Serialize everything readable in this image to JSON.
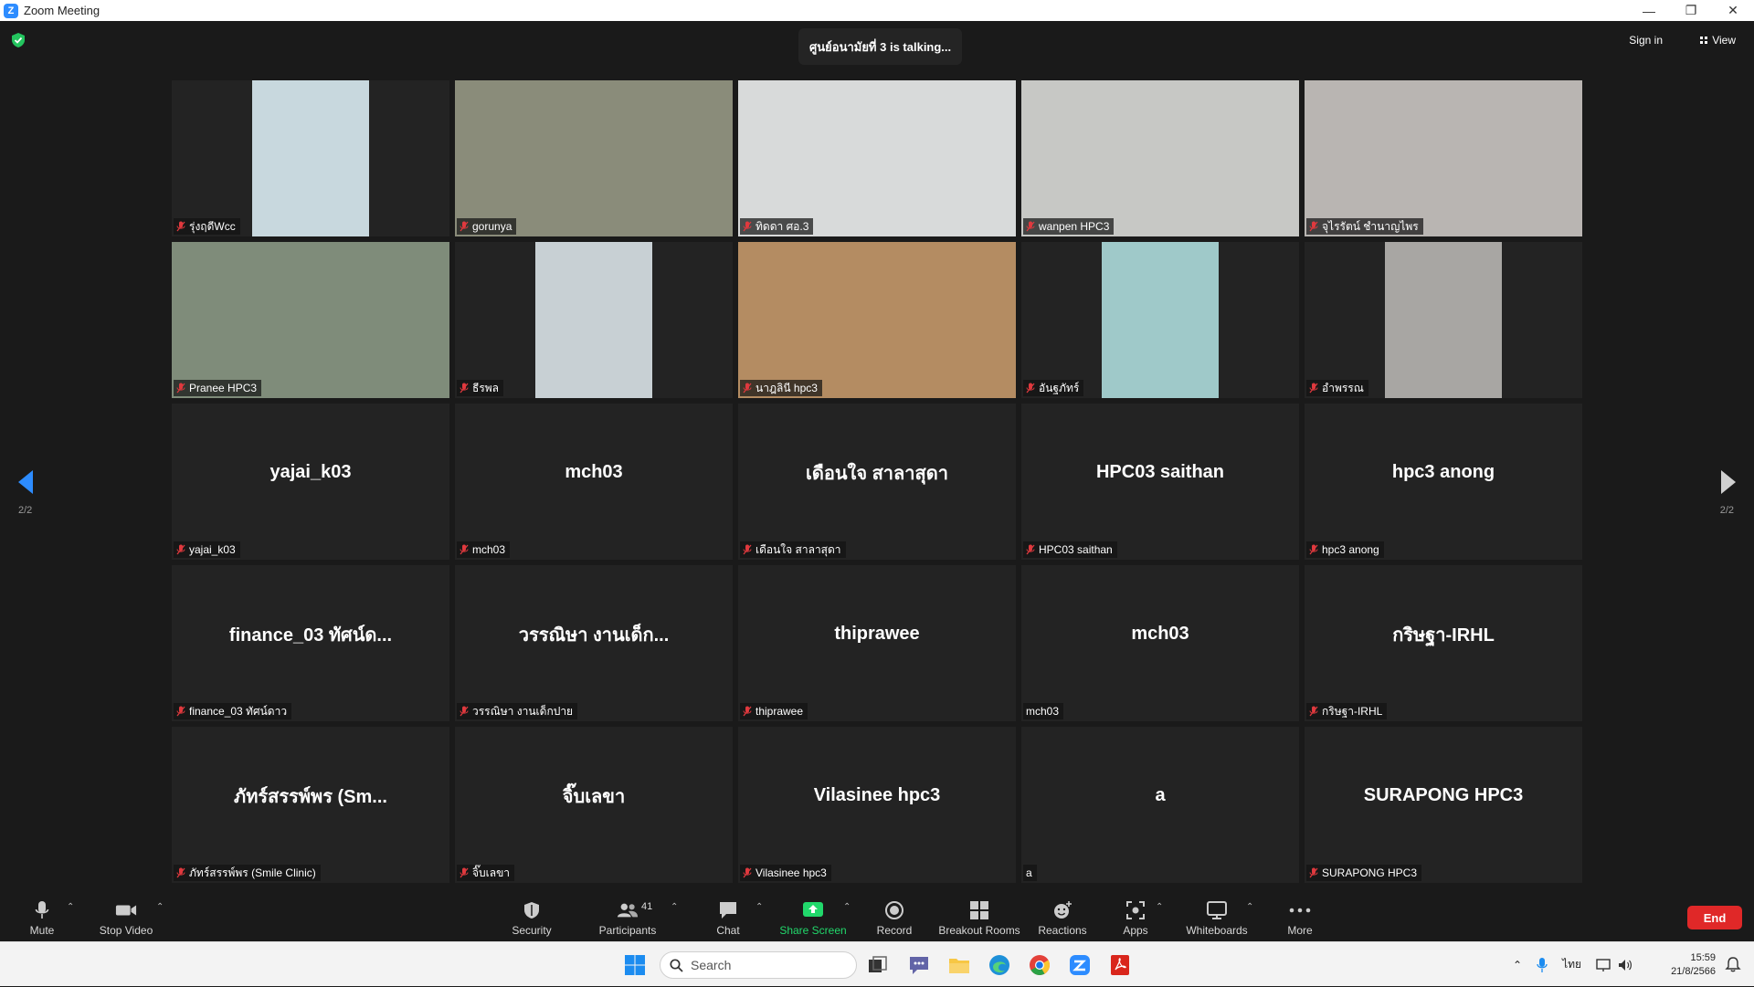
{
  "window": {
    "title": "Zoom Meeting",
    "minimize": "—",
    "restore": "❐",
    "close": "✕"
  },
  "header": {
    "talking": "ศูนย์อนามัยที่ 3 is  talking...",
    "signin": "Sign in",
    "view": "View"
  },
  "pagination": {
    "left": "2/2",
    "right": "2/2"
  },
  "participants": [
    {
      "label": "รุ่งฤดีWcc",
      "video": "narrow",
      "bg": "#c8d8de"
    },
    {
      "label": "gorunya",
      "video": "full",
      "bg": "#8a8c7a"
    },
    {
      "label": "ทิดดา ศอ.3",
      "video": "full",
      "bg": "#d8dada"
    },
    {
      "label": "wanpen HPC3",
      "video": "full",
      "bg": "#c7c8c5"
    },
    {
      "label": "จุไรรัตน์ ชำนาญไพร",
      "video": "full",
      "bg": "#b9b5b2"
    },
    {
      "label": "Pranee HPC3",
      "video": "full",
      "bg": "#7f8c7a"
    },
    {
      "label": "ธีรพล",
      "video": "narrow",
      "bg": "#c8d0d4"
    },
    {
      "label": "นาฎลินี  hpc3",
      "video": "full",
      "bg": "#b48c62"
    },
    {
      "label": "อันฐภัทร์",
      "video": "narrow",
      "bg": "#9fc9c9"
    },
    {
      "label": "อำพรรณ",
      "video": "narrow",
      "bg": "#a8a6a3"
    },
    {
      "name": "yajai_k03",
      "label": "yajai_k03"
    },
    {
      "name": "mch03",
      "label": "mch03"
    },
    {
      "name": "เดือนใจ  สาลาสุดา",
      "label": "เดือนใจ  สาลาสุดา"
    },
    {
      "name": "HPC03 saithan",
      "label": "HPC03 saithan"
    },
    {
      "name": "hpc3 anong",
      "label": "hpc3 anong"
    },
    {
      "name": "finance_03 ทัศน์ด...",
      "label": "finance_03 ทัศน์ดาว"
    },
    {
      "name": "วรรณิษา งานเด็ก...",
      "label": "วรรณิษา งานเด็กปาย"
    },
    {
      "name": "thiprawee",
      "label": "thiprawee"
    },
    {
      "name": "mch03",
      "label": "mch03",
      "unmuted": true
    },
    {
      "name": "กริษฐา-IRHL",
      "label": "กริษฐา-IRHL"
    },
    {
      "name": "ภัทร์สรรพ์พร (Sm...",
      "label": "ภัทร์สรรพ์พร (Smile Clinic)"
    },
    {
      "name": "จิ๊บเลขา",
      "label": "จิ๊บเลขา"
    },
    {
      "name": "Vilasinee hpc3",
      "label": "Vilasinee hpc3"
    },
    {
      "name": "a",
      "label": "a",
      "unmuted": true
    },
    {
      "name": "SURAPONG HPC3",
      "label": "SURAPONG HPC3"
    }
  ],
  "toolbar": {
    "mute": "Mute",
    "stop_video": "Stop Video",
    "security": "Security",
    "participants": "Participants",
    "participants_count": "41",
    "chat": "Chat",
    "share_screen": "Share Screen",
    "record": "Record",
    "breakout_rooms": "Breakout Rooms",
    "reactions": "Reactions",
    "apps": "Apps",
    "whiteboards": "Whiteboards",
    "more": "More",
    "end": "End"
  },
  "taskbar": {
    "search_placeholder": "Search",
    "language": "ไทย",
    "time": "15:59",
    "date": "21/8/2566"
  },
  "colors": {
    "accent": "#2d8cff",
    "share_green": "#21d86b",
    "end_red": "#e02828",
    "muted_red": "#e0393e"
  }
}
